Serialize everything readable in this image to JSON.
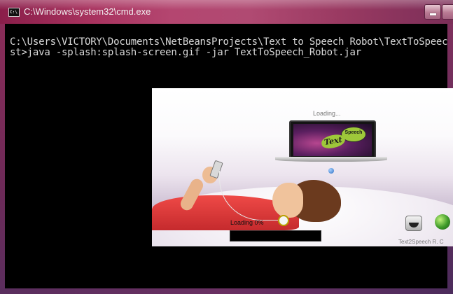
{
  "window": {
    "title": "C:\\Windows\\system32\\cmd.exe",
    "icon": "cmd-prompt-icon",
    "icon_text": "C:\\"
  },
  "console": {
    "lines": [
      "C:\\Users\\VICTORY\\Documents\\NetBeansProjects\\Text to Speech Robot\\TextToSpeech_Robot\\di",
      "st>java -splash:splash-screen.gif -jar TextToSpeech_Robot.jar"
    ]
  },
  "splash": {
    "loading_top": "Loading...",
    "logo_speech": "Speech",
    "logo_text": "Text",
    "loading_label": "Loading 0%",
    "progress_percent": 0,
    "footer": "Text2Speech R. C",
    "colors": {
      "progress_bg": "#000000",
      "accent_red": "#e03a3c",
      "logo_green": "#9ec83a"
    },
    "icons": [
      "speaker-icon",
      "globe-icon"
    ]
  }
}
